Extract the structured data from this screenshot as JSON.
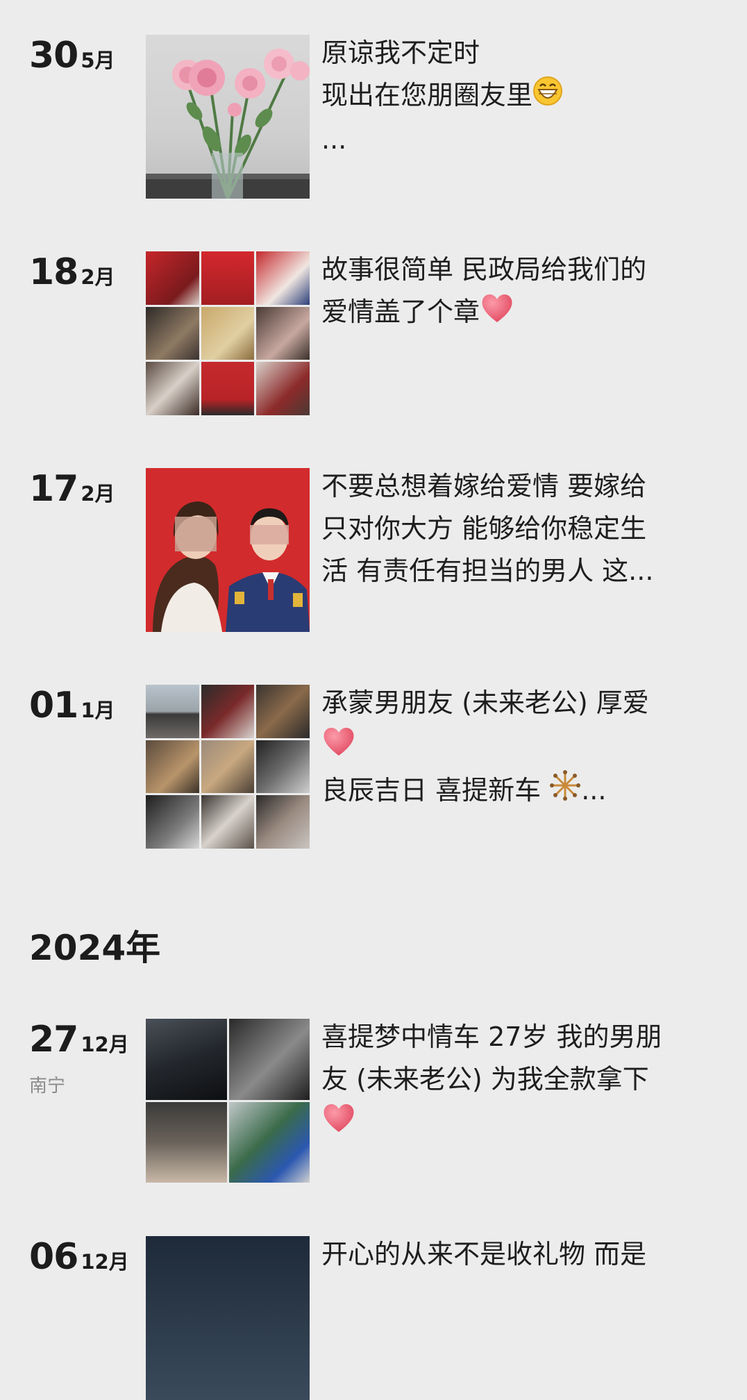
{
  "posts": [
    {
      "day": "30",
      "month": "5月",
      "lines": [
        "原谅我不定时",
        "现出在您朋圈友里",
        "..."
      ],
      "emoji_after_line": 1,
      "emoji": "grin-emoji"
    },
    {
      "day": "18",
      "month": "2月",
      "lines": [
        "故事很简单 民政局给我们的",
        "爱情盖了个章"
      ],
      "emoji_after_line": 1,
      "emoji": "heart-emoji"
    },
    {
      "day": "17",
      "month": "2月",
      "lines": [
        "不要总想着嫁给爱情 要嫁给",
        "只对你大方 能够给你稳定生",
        "活 有责任有担当的男人 这..."
      ]
    },
    {
      "day": "01",
      "month": "1月",
      "lines": [
        "承蒙男朋友 (未来老公) 厚爱",
        "",
        "良辰吉日 喜提新车",
        "..."
      ],
      "emoji": "heart-emoji",
      "emoji2": "fireworks-emoji"
    }
  ],
  "year_header": "2024年",
  "posts_2024": [
    {
      "day": "27",
      "month": "12月",
      "location": "南宁",
      "lines": [
        "喜提梦中情车 27岁 我的男朋",
        "友 (未来老公) 为我全款拿下"
      ],
      "emoji": "heart-emoji"
    },
    {
      "day": "06",
      "month": "12月",
      "lines": [
        "开心的从来不是收礼物 而是"
      ]
    }
  ],
  "colors": {
    "background": "#ececec",
    "heart": "#e8556a",
    "text": "#1e1e1e",
    "location": "#8a8a8a"
  }
}
